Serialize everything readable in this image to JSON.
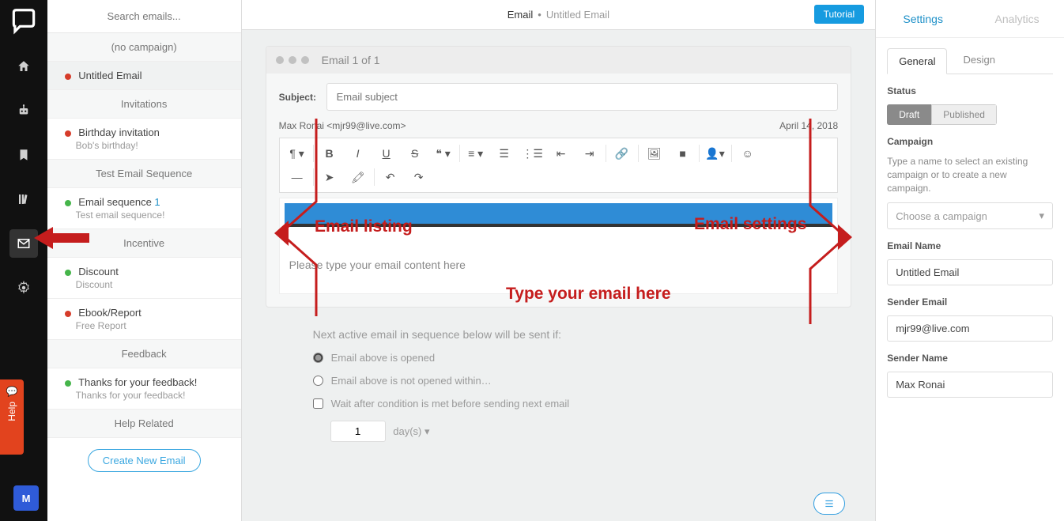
{
  "rail": {
    "avatar_initial": "M"
  },
  "help_tab": {
    "label": "Help"
  },
  "search": {
    "placeholder": "Search emails..."
  },
  "groups": [
    {
      "header": "(no campaign)",
      "items": [
        {
          "id": "untitled",
          "status": "red",
          "title": "Untitled Email",
          "sub": "",
          "selected": true
        }
      ]
    },
    {
      "header": "Invitations",
      "items": [
        {
          "id": "birthday",
          "status": "red",
          "title": "Birthday invitation",
          "sub": "Bob's birthday!"
        }
      ]
    },
    {
      "header": "Test Email Sequence",
      "items": [
        {
          "id": "seq",
          "status": "green",
          "title": "Email sequence",
          "seq": "1",
          "sub": "Test email sequence!"
        }
      ]
    },
    {
      "header": "Incentive",
      "items": [
        {
          "id": "discount",
          "status": "green",
          "title": "Discount",
          "sub": "Discount"
        },
        {
          "id": "ebook",
          "status": "red",
          "title": "Ebook/Report",
          "sub": "Free Report"
        }
      ]
    },
    {
      "header": "Feedback",
      "items": [
        {
          "id": "thanks",
          "status": "green",
          "title": "Thanks for your feedback!",
          "sub": "Thanks for your feedback!"
        }
      ]
    },
    {
      "header": "Help Related",
      "items": []
    }
  ],
  "create_button": "Create New Email",
  "header": {
    "type": "Email",
    "name": "Untitled Email",
    "tutorial": "Tutorial"
  },
  "editor": {
    "counter": "Email 1 of 1",
    "subject_label": "Subject:",
    "subject_placeholder": "Email subject",
    "from": "Max Ronai <mjr99@live.com>",
    "date": "April 14, 2018",
    "content_placeholder": "Please type your email content here"
  },
  "sequence": {
    "heading": "Next active email in sequence below will be sent if:",
    "opt_opened": "Email above is opened",
    "opt_not_opened": "Email above is not opened within…",
    "wait_label": "Wait after condition is met before sending next email",
    "days_value": "1",
    "days_unit": "day(s)"
  },
  "settings": {
    "tabs": {
      "settings": "Settings",
      "analytics": "Analytics"
    },
    "subtabs": {
      "general": "General",
      "design": "Design"
    },
    "status_label": "Status",
    "status_draft": "Draft",
    "status_published": "Published",
    "campaign_label": "Campaign",
    "campaign_hint": "Type a name to select an existing campaign or to create a new campaign.",
    "campaign_placeholder": "Choose a campaign",
    "email_name_label": "Email Name",
    "email_name_value": "Untitled Email",
    "sender_email_label": "Sender Email",
    "sender_email_value": "mjr99@live.com",
    "sender_name_label": "Sender Name",
    "sender_name_value": "Max Ronai"
  },
  "annotations": {
    "listing": "Email listing",
    "type_here": "Type your email here",
    "settings": "Email settings"
  }
}
